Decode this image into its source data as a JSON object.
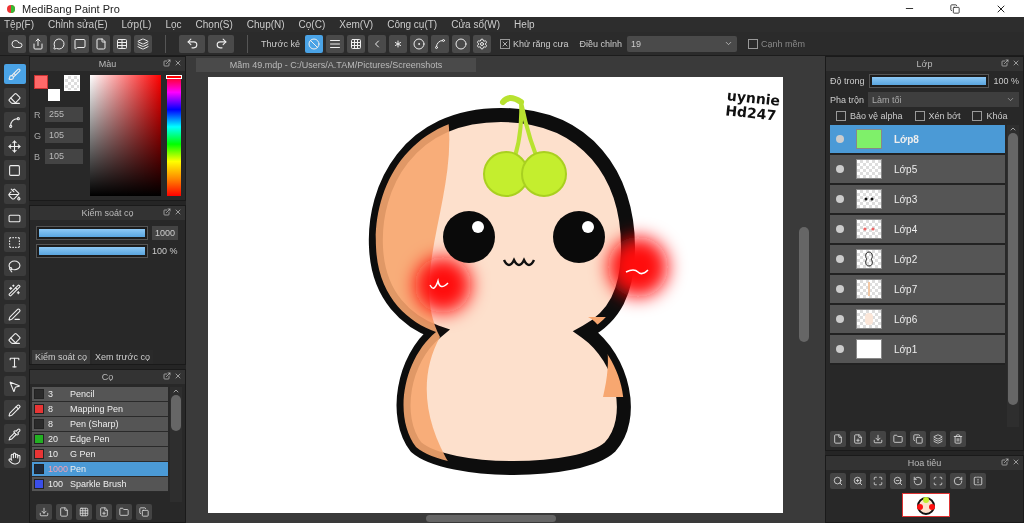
{
  "window": {
    "title": "MediBang Paint Pro"
  },
  "menu": [
    "Tệp(F)",
    "Chỉnh sửa(E)",
    "Lớp(L)",
    "Lọc",
    "Chọn(S)",
    "Chụp(N)",
    "Cọ(C)",
    "Xem(V)",
    "Công cụ(T)",
    "Cửa sổ(W)",
    "Help"
  ],
  "toolbar": {
    "ruler_label": "Thước kẻ",
    "rulers": [
      {
        "selected": true
      },
      {
        "selected": false
      },
      {
        "selected": false
      },
      {
        "selected": false
      },
      {
        "selected": false
      },
      {
        "selected": false
      },
      {
        "selected": false
      },
      {
        "selected": false
      },
      {
        "selected": false
      }
    ],
    "antialias": {
      "label": "Khử răng cưa",
      "checked": true
    },
    "adjust": {
      "label": "Điều chỉnh",
      "value": "19"
    },
    "soft_edge": {
      "label": "Cạnh mềm",
      "checked": false
    }
  },
  "tools": [
    {
      "selected": true
    },
    {
      "selected": false
    },
    {
      "selected": false
    },
    {
      "selected": false
    },
    {
      "selected": false
    },
    {
      "selected": false
    },
    {
      "selected": false
    },
    {
      "selected": false
    },
    {
      "selected": false
    },
    {
      "selected": false
    },
    {
      "selected": false
    },
    {
      "selected": false
    },
    {
      "selected": false
    },
    {
      "selected": false
    },
    {
      "selected": false
    },
    {
      "selected": false
    },
    {
      "selected": false
    }
  ],
  "color_panel": {
    "title": "Màu",
    "swatches": [
      {
        "kind": "foreground",
        "color": "#ff6969"
      },
      {
        "kind": "background",
        "color": "#ffffff"
      },
      {
        "kind": "transparent"
      }
    ],
    "channels": [
      {
        "label": "R",
        "value": "255"
      },
      {
        "label": "G",
        "value": "105"
      },
      {
        "label": "B",
        "value": "105"
      }
    ],
    "hue": {
      "level": 0
    }
  },
  "brush_control": {
    "title": "Kiểm soát cọ",
    "size": {
      "level": 1,
      "value": "1000"
    },
    "opacity": {
      "level": 1,
      "reading": "100 %"
    }
  },
  "panel_tabs": [
    {
      "label": "Kiểm soát cọ",
      "selected": true
    },
    {
      "label": "Xem trước cọ",
      "selected": false
    }
  ],
  "brush_panel": {
    "title": "Cọ",
    "items": [
      {
        "color": "#2a2a2a",
        "size": "3",
        "name": "Pencil",
        "selected": false
      },
      {
        "color": "#e83434",
        "size": "8",
        "name": "Mapping Pen",
        "selected": false
      },
      {
        "color": "#2a2a2a",
        "size": "8",
        "name": "Pen (Sharp)",
        "selected": false
      },
      {
        "color": "#22b022",
        "size": "20",
        "name": "Edge Pen",
        "selected": false
      },
      {
        "color": "#e83434",
        "size": "10",
        "name": "G Pen",
        "selected": false
      },
      {
        "color": "#1d2a3a",
        "size": "1000",
        "name": "Pen",
        "selected": true
      },
      {
        "color": "#3a4ee8",
        "size": "100",
        "name": "Sparkle Brush",
        "selected": false
      }
    ]
  },
  "document": {
    "tab": "Mầm 49.mdp - C:/Users/A.TAM/Pictures/Screenshots",
    "signature": [
      "uynnie",
      "Hd247"
    ]
  },
  "layer_panel": {
    "title": "Lớp",
    "opacity": {
      "label": "Độ trong",
      "level": 1,
      "reading": "100 %"
    },
    "blend": {
      "label": "Pha trộn",
      "value": "Làm tối"
    },
    "options": [
      {
        "label": "Bảo vệ alpha",
        "checked": false
      },
      {
        "label": "Xén bớt",
        "checked": false
      },
      {
        "label": "Khóa",
        "checked": false
      }
    ],
    "layers": [
      {
        "name": "Lớp8",
        "kind": "green",
        "selected": true
      },
      {
        "name": "Lớp5",
        "kind": "blank",
        "selected": false
      },
      {
        "name": "Lớp3",
        "kind": "eyes",
        "selected": false
      },
      {
        "name": "Lớp4",
        "kind": "cheeks",
        "selected": false
      },
      {
        "name": "Lớp2",
        "kind": "outline",
        "selected": false
      },
      {
        "name": "Lớp7",
        "kind": "stroke",
        "selected": false
      },
      {
        "name": "Lớp6",
        "kind": "peach",
        "selected": false
      },
      {
        "name": "Lớp1",
        "kind": "white",
        "selected": false
      }
    ]
  },
  "navigator": {
    "title": "Hoa tiêu"
  }
}
